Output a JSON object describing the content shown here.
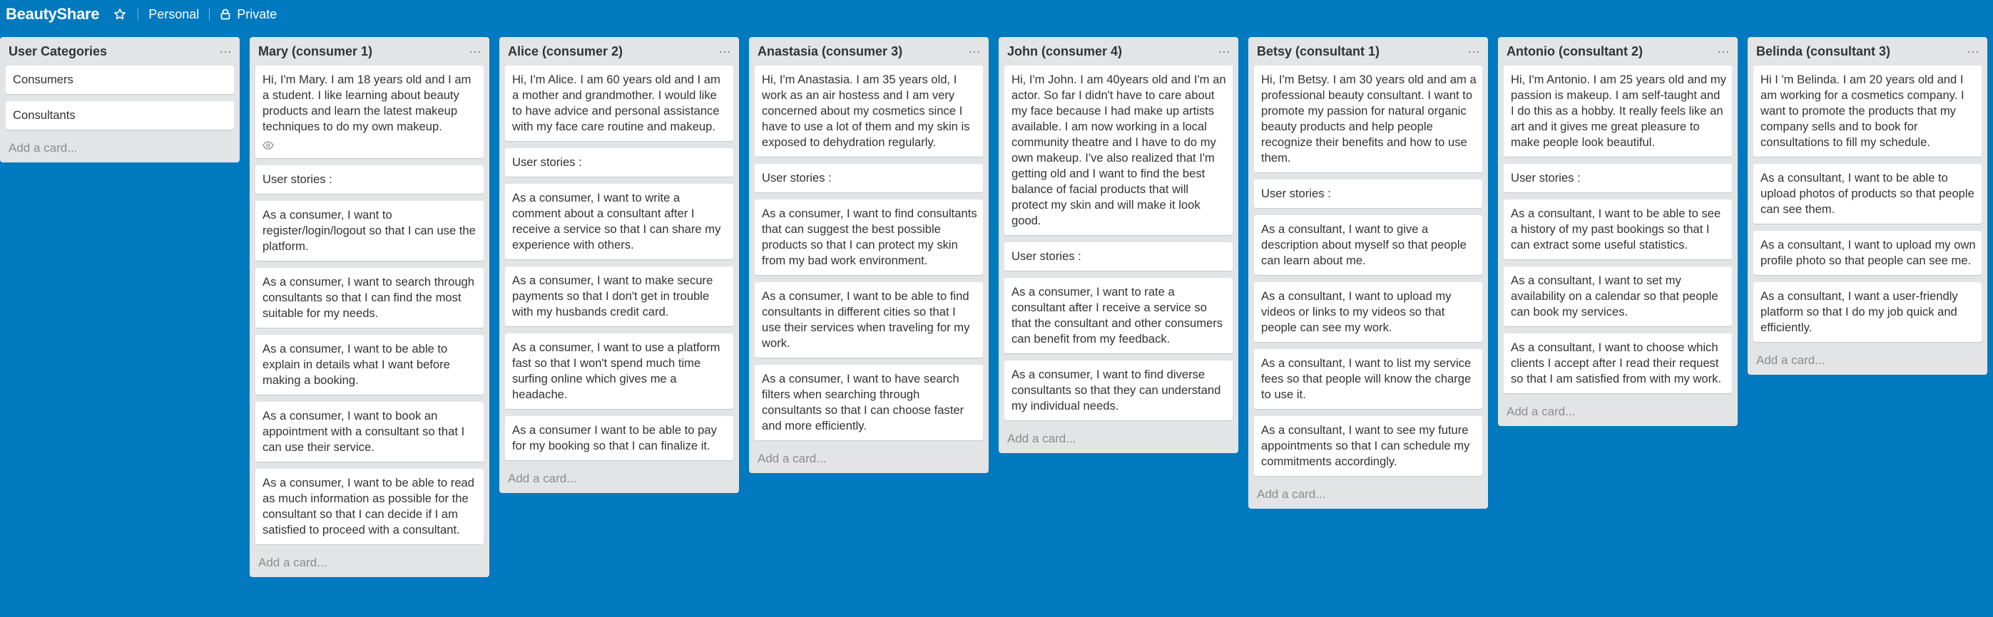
{
  "header": {
    "board_title": "BeautyShare",
    "team_label": "Personal",
    "visibility_label": "Private"
  },
  "colors": {
    "background": "#0079bf",
    "list_bg": "#e2e4e6",
    "card_bg": "#ffffff"
  },
  "lists": [
    {
      "title": "User Categories",
      "add_card": "Add a card...",
      "cards": [
        {
          "text": "Consumers"
        },
        {
          "text": "Consultants"
        }
      ]
    },
    {
      "title": "Mary (consumer 1)",
      "add_card": "Add a card...",
      "cards": [
        {
          "text": "Hi, I'm Mary. I am 18 years old and I am a student. I like learning about beauty products and learn the latest makeup techniques to do my own makeup.",
          "badge": "eye-icon"
        },
        {
          "text": "User stories :"
        },
        {
          "text": "As a consumer, I want to register/login/logout so that I can use the platform."
        },
        {
          "text": "As a consumer, I want to search through consultants so that I can find the most suitable for my needs."
        },
        {
          "text": "As a consumer, I want to be able to explain in details what I want before making a booking."
        },
        {
          "text": "As a consumer, I want to book an appointment with a consultant so that I can use their service."
        },
        {
          "text": "As a consumer, I want to be able to read as much information as possible for the consultant so that I can decide if I am satisfied to proceed with a consultant."
        }
      ]
    },
    {
      "title": "Alice (consumer 2)",
      "add_card": "Add a card...",
      "cards": [
        {
          "text": "Hi, I'm Alice. I am 60 years old and I am a mother and grandmother. I would like to have advice and personal assistance with my face care routine and makeup."
        },
        {
          "text": "User stories :"
        },
        {
          "text": "As a consumer, I want to write a comment about a consultant after I receive a service so that I can share my experience with others."
        },
        {
          "text": "As a consumer, I want to make secure payments so that I don't get in trouble with my husbands credit card."
        },
        {
          "text": "As a consumer, I want to use a platform fast so that I won't spend much time surfing online which gives me a headache."
        },
        {
          "text": "As a consumer I want to be able to pay for my booking so that I can finalize it."
        }
      ]
    },
    {
      "title": "Anastasia (consumer 3)",
      "add_card": "Add a card...",
      "cards": [
        {
          "text": "Hi, I'm Anastasia. I am 35 years old, I work as an air hostess and I am very concerned about my cosmetics since I have to use a lot of them and my skin is exposed to dehydration regularly."
        },
        {
          "text": "User stories :"
        },
        {
          "text": "As a consumer, I want to find consultants that can suggest the best possible products so that I can protect my skin from my bad work environment."
        },
        {
          "text": "As a consumer, I want to be able to find consultants in different cities so that I use their services when traveling for my work."
        },
        {
          "text": "As a consumer, I want to have search filters when searching through consultants so that I can choose faster and more efficiently."
        }
      ]
    },
    {
      "title": "John (consumer 4)",
      "add_card": "Add a card...",
      "cards": [
        {
          "text": "Hi, I'm John. I am 40years old and I'm an actor. So far I didn't have to care about my face because I had make up artists available. I am now working in a local community theatre and I have to do my own makeup. I've also realized that I'm getting old and I want to find the best balance of facial products that will protect my skin and will make it look good."
        },
        {
          "text": "User stories :"
        },
        {
          "text": "As a consumer, I want to rate a consultant after I receive a service so that the consultant and other consumers can benefit from my feedback."
        },
        {
          "text": "As a consumer, I want to find diverse consultants so that they can understand my individual needs."
        }
      ]
    },
    {
      "title": "Betsy (consultant 1)",
      "add_card": "Add a card...",
      "cards": [
        {
          "text": "Hi, I'm Betsy. I am 30 years old and am a professional beauty consultant. I want to promote my passion for natural organic beauty products and help people recognize their benefits and how to use them."
        },
        {
          "text": "User stories :"
        },
        {
          "text": "As a consultant, I want to give a description about myself so that people can learn about me."
        },
        {
          "text": "As a consultant, I want to upload my videos or links to my videos so that people can see my work."
        },
        {
          "text": "As a consultant, I want to list my service fees so that people will know the charge to use it."
        },
        {
          "text": "As a consultant, I want to see my future appointments so that I can schedule my commitments accordingly."
        }
      ]
    },
    {
      "title": "Antonio (consultant 2)",
      "add_card": "Add a card...",
      "cards": [
        {
          "text": "Hi, I'm Antonio. I am 25 years old and my passion is makeup. I am self-taught and I do this as a hobby. It really feels like an art and it gives me great pleasure to make people look beautiful."
        },
        {
          "text": "User stories :"
        },
        {
          "text": "As a consultant, I want to be able to see a history of my past bookings so that I can extract some useful statistics."
        },
        {
          "text": "As a consultant, I want to set my availability on a calendar so that people can book my services."
        },
        {
          "text": "As a consultant, I want to choose which clients I accept after I read their request so that I am satisfied from with my work."
        }
      ]
    },
    {
      "title": "Belinda (consultant 3)",
      "add_card": "Add a card...",
      "cards": [
        {
          "text": "Hi I 'm Belinda. I am 20 years old and I am working for a cosmetics company. I want to promote the products that my company sells and to book for consultations to fill my schedule."
        },
        {
          "text": "As a consultant, I want to be able to upload photos of products so that people can see them."
        },
        {
          "text": "As a consultant, I want to upload my own profile photo so that people can see me."
        },
        {
          "text": "As a consultant, I want a user-friendly platform so that I do my job quick and efficiently."
        }
      ]
    }
  ]
}
